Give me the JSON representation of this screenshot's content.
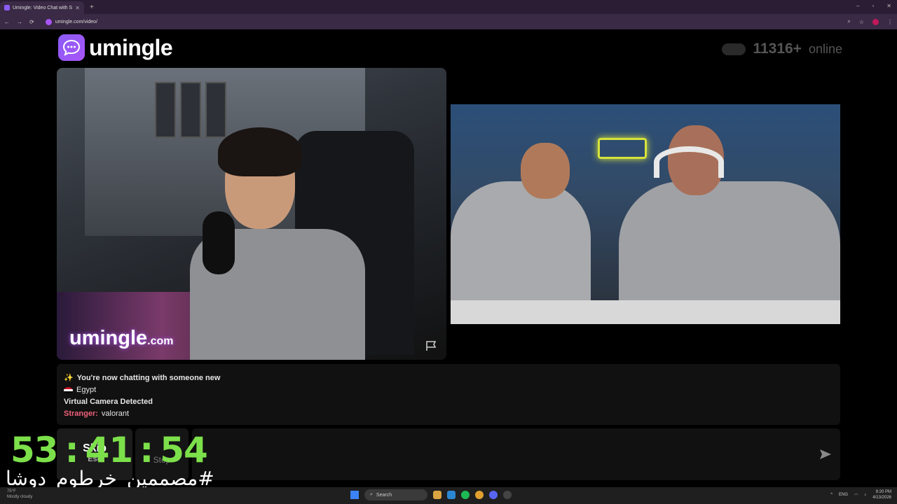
{
  "browser": {
    "tab_title": "Umingle: Video Chat with S",
    "new_tab": "+",
    "url": "umingle.com/video/",
    "window_controls": [
      "–",
      "▫",
      "✕"
    ]
  },
  "site": {
    "logo_text": "umingle",
    "online_count": "11316+",
    "online_word": "online",
    "watermark": "umingle",
    "watermark_suffix": ".com"
  },
  "chat": {
    "connected_msg": "You're now chatting with someone new",
    "country": "Egypt",
    "camera_msg": "Virtual Camera Detected",
    "stranger_label": "Stranger:",
    "stranger_msg": "valorant"
  },
  "controls": {
    "skip_label": "Skip",
    "skip_key": "Esc",
    "stop_label": "Stop"
  },
  "overlay": {
    "timer_h": "53",
    "timer_m": "41",
    "timer_s": "54",
    "sep": ":",
    "hashtag": "#مصممين_خرطوم_دوشا"
  },
  "taskbar": {
    "weather_temp": "75°F",
    "weather_desc": "Mostly cloudy",
    "search": "Search",
    "lang": "ENG",
    "time": "9:20 PM",
    "date": "4/13/2026"
  },
  "colors": {
    "brand": "#8b5cf6",
    "timer": "#7ce04a",
    "stranger": "#f0607a"
  }
}
